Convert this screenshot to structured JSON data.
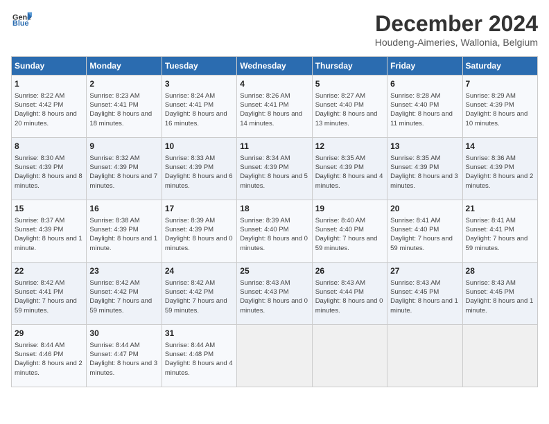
{
  "logo": {
    "general": "General",
    "blue": "Blue"
  },
  "header": {
    "month": "December 2024",
    "location": "Houdeng-Aimeries, Wallonia, Belgium"
  },
  "days_of_week": [
    "Sunday",
    "Monday",
    "Tuesday",
    "Wednesday",
    "Thursday",
    "Friday",
    "Saturday"
  ],
  "weeks": [
    [
      {
        "day": "1",
        "sunrise": "Sunrise: 8:22 AM",
        "sunset": "Sunset: 4:42 PM",
        "daylight": "Daylight: 8 hours and 20 minutes."
      },
      {
        "day": "2",
        "sunrise": "Sunrise: 8:23 AM",
        "sunset": "Sunset: 4:41 PM",
        "daylight": "Daylight: 8 hours and 18 minutes."
      },
      {
        "day": "3",
        "sunrise": "Sunrise: 8:24 AM",
        "sunset": "Sunset: 4:41 PM",
        "daylight": "Daylight: 8 hours and 16 minutes."
      },
      {
        "day": "4",
        "sunrise": "Sunrise: 8:26 AM",
        "sunset": "Sunset: 4:41 PM",
        "daylight": "Daylight: 8 hours and 14 minutes."
      },
      {
        "day": "5",
        "sunrise": "Sunrise: 8:27 AM",
        "sunset": "Sunset: 4:40 PM",
        "daylight": "Daylight: 8 hours and 13 minutes."
      },
      {
        "day": "6",
        "sunrise": "Sunrise: 8:28 AM",
        "sunset": "Sunset: 4:40 PM",
        "daylight": "Daylight: 8 hours and 11 minutes."
      },
      {
        "day": "7",
        "sunrise": "Sunrise: 8:29 AM",
        "sunset": "Sunset: 4:39 PM",
        "daylight": "Daylight: 8 hours and 10 minutes."
      }
    ],
    [
      {
        "day": "8",
        "sunrise": "Sunrise: 8:30 AM",
        "sunset": "Sunset: 4:39 PM",
        "daylight": "Daylight: 8 hours and 8 minutes."
      },
      {
        "day": "9",
        "sunrise": "Sunrise: 8:32 AM",
        "sunset": "Sunset: 4:39 PM",
        "daylight": "Daylight: 8 hours and 7 minutes."
      },
      {
        "day": "10",
        "sunrise": "Sunrise: 8:33 AM",
        "sunset": "Sunset: 4:39 PM",
        "daylight": "Daylight: 8 hours and 6 minutes."
      },
      {
        "day": "11",
        "sunrise": "Sunrise: 8:34 AM",
        "sunset": "Sunset: 4:39 PM",
        "daylight": "Daylight: 8 hours and 5 minutes."
      },
      {
        "day": "12",
        "sunrise": "Sunrise: 8:35 AM",
        "sunset": "Sunset: 4:39 PM",
        "daylight": "Daylight: 8 hours and 4 minutes."
      },
      {
        "day": "13",
        "sunrise": "Sunrise: 8:35 AM",
        "sunset": "Sunset: 4:39 PM",
        "daylight": "Daylight: 8 hours and 3 minutes."
      },
      {
        "day": "14",
        "sunrise": "Sunrise: 8:36 AM",
        "sunset": "Sunset: 4:39 PM",
        "daylight": "Daylight: 8 hours and 2 minutes."
      }
    ],
    [
      {
        "day": "15",
        "sunrise": "Sunrise: 8:37 AM",
        "sunset": "Sunset: 4:39 PM",
        "daylight": "Daylight: 8 hours and 1 minute."
      },
      {
        "day": "16",
        "sunrise": "Sunrise: 8:38 AM",
        "sunset": "Sunset: 4:39 PM",
        "daylight": "Daylight: 8 hours and 1 minute."
      },
      {
        "day": "17",
        "sunrise": "Sunrise: 8:39 AM",
        "sunset": "Sunset: 4:39 PM",
        "daylight": "Daylight: 8 hours and 0 minutes."
      },
      {
        "day": "18",
        "sunrise": "Sunrise: 8:39 AM",
        "sunset": "Sunset: 4:40 PM",
        "daylight": "Daylight: 8 hours and 0 minutes."
      },
      {
        "day": "19",
        "sunrise": "Sunrise: 8:40 AM",
        "sunset": "Sunset: 4:40 PM",
        "daylight": "Daylight: 7 hours and 59 minutes."
      },
      {
        "day": "20",
        "sunrise": "Sunrise: 8:41 AM",
        "sunset": "Sunset: 4:40 PM",
        "daylight": "Daylight: 7 hours and 59 minutes."
      },
      {
        "day": "21",
        "sunrise": "Sunrise: 8:41 AM",
        "sunset": "Sunset: 4:41 PM",
        "daylight": "Daylight: 7 hours and 59 minutes."
      }
    ],
    [
      {
        "day": "22",
        "sunrise": "Sunrise: 8:42 AM",
        "sunset": "Sunset: 4:41 PM",
        "daylight": "Daylight: 7 hours and 59 minutes."
      },
      {
        "day": "23",
        "sunrise": "Sunrise: 8:42 AM",
        "sunset": "Sunset: 4:42 PM",
        "daylight": "Daylight: 7 hours and 59 minutes."
      },
      {
        "day": "24",
        "sunrise": "Sunrise: 8:42 AM",
        "sunset": "Sunset: 4:42 PM",
        "daylight": "Daylight: 7 hours and 59 minutes."
      },
      {
        "day": "25",
        "sunrise": "Sunrise: 8:43 AM",
        "sunset": "Sunset: 4:43 PM",
        "daylight": "Daylight: 8 hours and 0 minutes."
      },
      {
        "day": "26",
        "sunrise": "Sunrise: 8:43 AM",
        "sunset": "Sunset: 4:44 PM",
        "daylight": "Daylight: 8 hours and 0 minutes."
      },
      {
        "day": "27",
        "sunrise": "Sunrise: 8:43 AM",
        "sunset": "Sunset: 4:45 PM",
        "daylight": "Daylight: 8 hours and 1 minute."
      },
      {
        "day": "28",
        "sunrise": "Sunrise: 8:43 AM",
        "sunset": "Sunset: 4:45 PM",
        "daylight": "Daylight: 8 hours and 1 minute."
      }
    ],
    [
      {
        "day": "29",
        "sunrise": "Sunrise: 8:44 AM",
        "sunset": "Sunset: 4:46 PM",
        "daylight": "Daylight: 8 hours and 2 minutes."
      },
      {
        "day": "30",
        "sunrise": "Sunrise: 8:44 AM",
        "sunset": "Sunset: 4:47 PM",
        "daylight": "Daylight: 8 hours and 3 minutes."
      },
      {
        "day": "31",
        "sunrise": "Sunrise: 8:44 AM",
        "sunset": "Sunset: 4:48 PM",
        "daylight": "Daylight: 8 hours and 4 minutes."
      },
      null,
      null,
      null,
      null
    ]
  ]
}
